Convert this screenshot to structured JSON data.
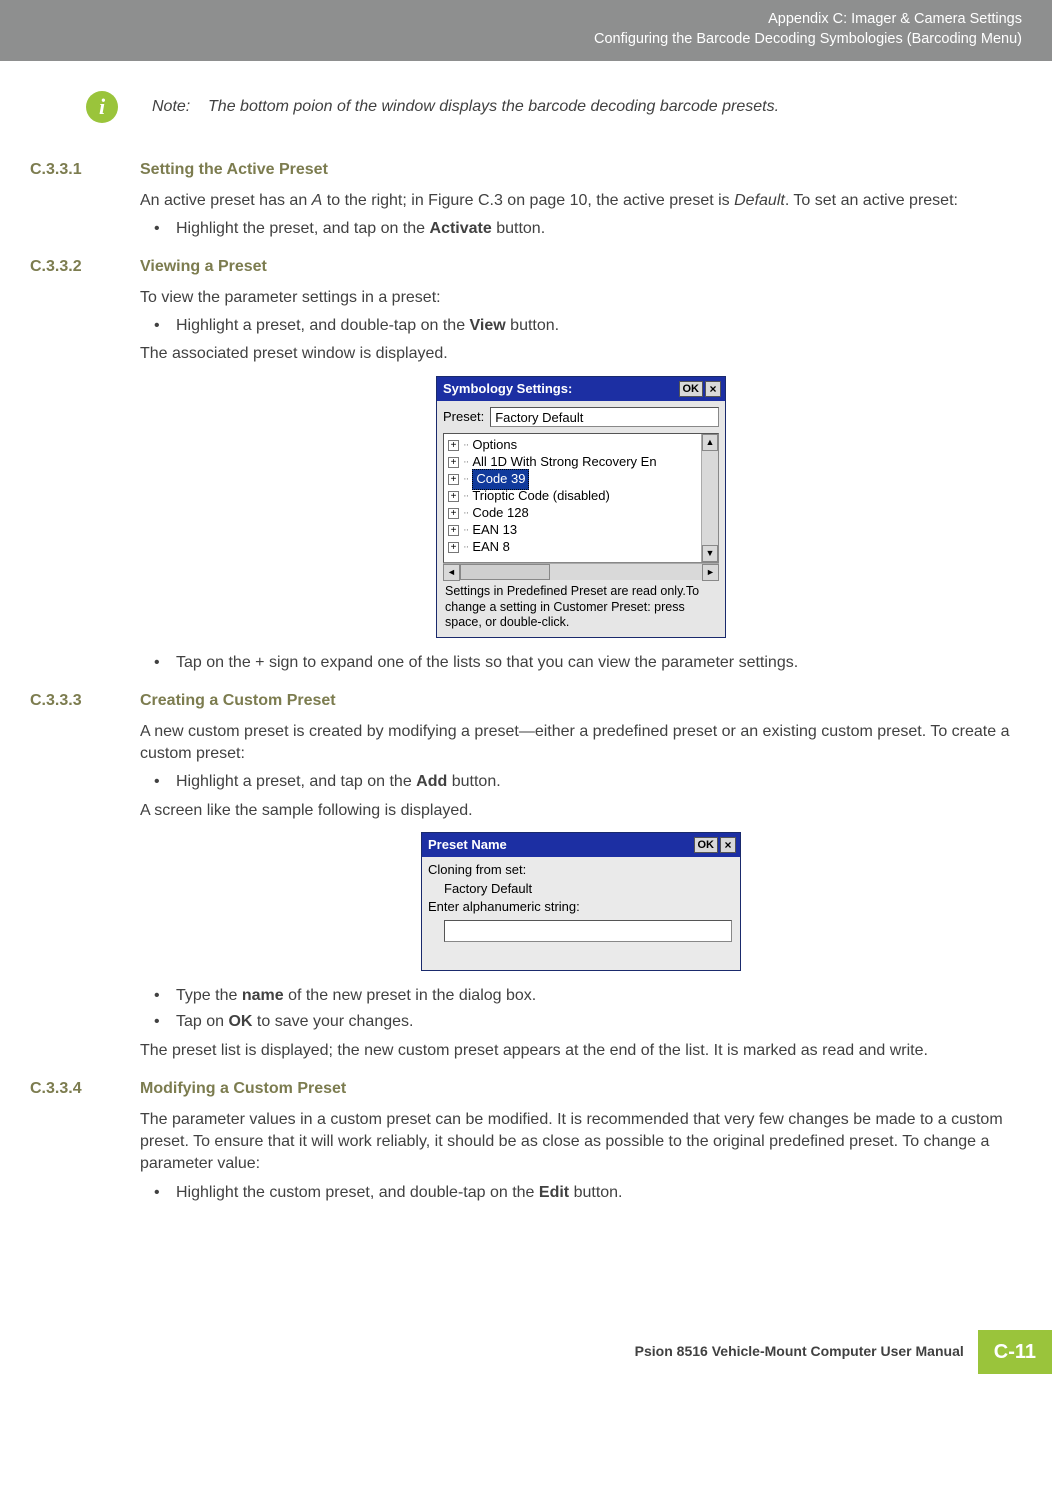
{
  "header": {
    "line1": "Appendix C: Imager & Camera Settings",
    "line2": "Configuring the Barcode Decoding Symbologies (Barcoding Menu)"
  },
  "note": {
    "label": "Note:",
    "text": "The bottom poion of the window displays the barcode decoding barcode presets."
  },
  "sections": {
    "s1": {
      "num": "C.3.3.1",
      "title": "Setting the Active Preset",
      "p1a": "An active preset has an ",
      "p1b": "A",
      "p1c": " to the right; in Figure C.3 on page 10, the active preset is ",
      "p1d": "Default",
      "p1e": ". To set an active preset:",
      "b1a": "Highlight the preset, and tap on the ",
      "b1b": "Activate",
      "b1c": " button."
    },
    "s2": {
      "num": "C.3.3.2",
      "title": "Viewing a Preset",
      "p1": "To view the parameter settings in a preset:",
      "b1a": "Highlight a preset, and double-tap on the ",
      "b1b": "View",
      "b1c": " button.",
      "p2": "The associated preset window is displayed.",
      "b2": "Tap on the + sign to expand one of the lists so that you can view the parameter settings."
    },
    "s3": {
      "num": "C.3.3.3",
      "title": "Creating a Custom Preset",
      "p1": "A new custom preset is created by modifying a preset—either a predefined preset or an existing custom preset. To create a custom preset:",
      "b1a": "Highlight a preset, and tap on the ",
      "b1b": "Add",
      "b1c": " button.",
      "p2": "A screen like the sample following is displayed.",
      "b2a": "Type the ",
      "b2b": "name",
      "b2c": " of the new preset in the dialog box.",
      "b3a": "Tap on ",
      "b3b": "OK",
      "b3c": " to save your changes.",
      "p3": "The preset list is displayed; the new custom preset appears at the end of the list. It is marked as read and write."
    },
    "s4": {
      "num": "C.3.3.4",
      "title": "Modifying a Custom Preset",
      "p1": "The parameter values in a custom preset can be modified. It is recommended that very few changes be made to a custom preset. To ensure that it will work reliably, it should be as close as possible to the original predefined preset. To change a parameter value:",
      "b1a": "Highlight the custom preset, and double-tap on the ",
      "b1b": "Edit",
      "b1c": " button."
    }
  },
  "win1": {
    "title": "Symbology Settings:",
    "ok": "OK",
    "close": "×",
    "preset_label": "Preset:",
    "preset_value": "Factory Default",
    "tree": {
      "r0": "Options",
      "r1": "All 1D With Strong Recovery En",
      "r2": "Code 39",
      "r3": "Trioptic Code (disabled)",
      "r4": "Code 128",
      "r5": "EAN 13",
      "r6": "EAN 8"
    },
    "status": "Settings in Predefined Preset are read only.To change a setting in Customer Preset: press space, or double-click."
  },
  "win2": {
    "title": "Preset Name",
    "ok": "OK",
    "close": "×",
    "l1": "Cloning from set:",
    "l2": "Factory Default",
    "l3": "Enter alphanumeric string:"
  },
  "footer": {
    "text": "Psion 8516 Vehicle-Mount Computer User Manual",
    "page": "C-11"
  }
}
